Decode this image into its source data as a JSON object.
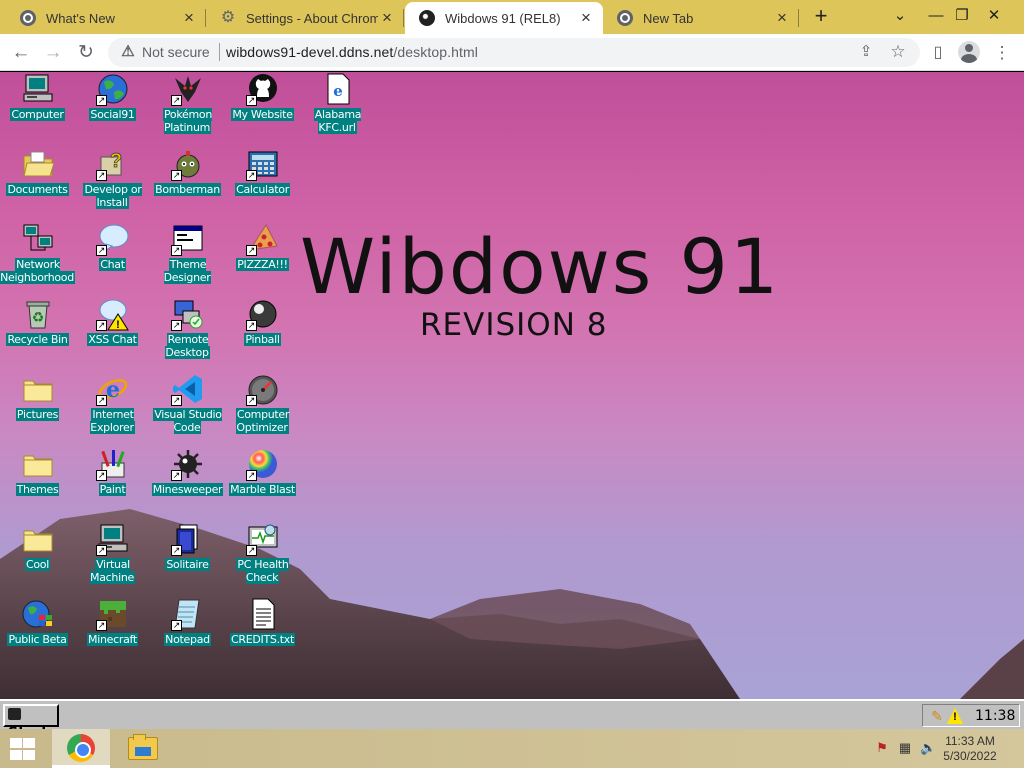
{
  "browser": {
    "tabs": [
      {
        "label": "What's New",
        "icon": "chrome-icon",
        "active": false
      },
      {
        "label": "Settings - About Chrome",
        "icon": "gear-icon",
        "active": false
      },
      {
        "label": "Wibdows 91 (REL8)",
        "icon": "wibdows-icon",
        "active": true
      },
      {
        "label": "New Tab",
        "icon": "chrome-icon",
        "active": false
      }
    ],
    "new_tab": "+",
    "tab_close": "×",
    "window_controls": {
      "dropdown": "⌄",
      "minimize": "—",
      "restore": "❐",
      "close": "✕"
    },
    "nav": {
      "back": "←",
      "forward": "→",
      "reload": "↻"
    },
    "security": "Not secure",
    "url_host": "wibdows91-devel.ddns.net",
    "url_path": "/desktop.html",
    "omni_icons": {
      "share": "⇪",
      "bookmark": "☆",
      "side_panel": "▯",
      "menu": "⋮"
    }
  },
  "desktop": {
    "title": "Wibdows 91",
    "subtitle": "REVISION 8",
    "icons": [
      {
        "label": "Computer",
        "shortcut": false,
        "kind": "computer"
      },
      {
        "label": "Social91",
        "shortcut": true,
        "kind": "globe"
      },
      {
        "label": "Pokémon Platinum",
        "shortcut": true,
        "kind": "giratina"
      },
      {
        "label": "My Website",
        "shortcut": true,
        "kind": "github"
      },
      {
        "label": "Alabama KFC.url",
        "shortcut": false,
        "kind": "ie-doc"
      },
      {
        "label": "Documents",
        "shortcut": false,
        "kind": "folder-open"
      },
      {
        "label": "Develop or Install",
        "shortcut": true,
        "kind": "help"
      },
      {
        "label": "Bomberman",
        "shortcut": true,
        "kind": "bomber"
      },
      {
        "label": "Calculator",
        "shortcut": true,
        "kind": "calculator"
      },
      {
        "label": "Network Neighborhood",
        "shortcut": false,
        "kind": "network"
      },
      {
        "label": "Chat",
        "shortcut": true,
        "kind": "bubble"
      },
      {
        "label": "Theme Designer",
        "shortcut": true,
        "kind": "window"
      },
      {
        "label": "PIZZZA!!!",
        "shortcut": true,
        "kind": "pizza"
      },
      {
        "label": "Recycle Bin",
        "shortcut": false,
        "kind": "recycle"
      },
      {
        "label": "XSS Chat",
        "shortcut": true,
        "kind": "bubble-warn"
      },
      {
        "label": "Remote Desktop",
        "shortcut": true,
        "kind": "remote"
      },
      {
        "label": "Pinball",
        "shortcut": true,
        "kind": "ball"
      },
      {
        "label": "Pictures",
        "shortcut": false,
        "kind": "folder"
      },
      {
        "label": "Internet Explorer",
        "shortcut": true,
        "kind": "ie"
      },
      {
        "label": "Visual Studio Code",
        "shortcut": true,
        "kind": "vscode"
      },
      {
        "label": "Computer Optimizer",
        "shortcut": true,
        "kind": "gauge"
      },
      {
        "label": "Themes",
        "shortcut": false,
        "kind": "folder"
      },
      {
        "label": "Paint",
        "shortcut": true,
        "kind": "paint"
      },
      {
        "label": "Minesweeper",
        "shortcut": true,
        "kind": "mine"
      },
      {
        "label": "Marble Blast",
        "shortcut": true,
        "kind": "marble"
      },
      {
        "label": "Cool",
        "shortcut": false,
        "kind": "folder"
      },
      {
        "label": "Virtual Machine",
        "shortcut": true,
        "kind": "computer"
      },
      {
        "label": "Solitaire",
        "shortcut": true,
        "kind": "cards"
      },
      {
        "label": "PC Health Check",
        "shortcut": true,
        "kind": "health"
      },
      {
        "label": "Public Beta",
        "shortcut": false,
        "kind": "globe-win"
      },
      {
        "label": "Minecraft",
        "shortcut": true,
        "kind": "block"
      },
      {
        "label": "Notepad",
        "shortcut": true,
        "kind": "notepad"
      },
      {
        "label": "CREDITS.txt",
        "shortcut": false,
        "kind": "text"
      }
    ]
  },
  "w91_taskbar": {
    "start_label": "Start",
    "clock": "11:38",
    "tray_icons": [
      "pencil-icon",
      "warning-icon"
    ]
  },
  "host_taskbar": {
    "apps": [
      "chrome",
      "file-explorer"
    ],
    "time": "11:33 AM",
    "date": "5/30/2022",
    "tray_icons": [
      "flag-icon",
      "network-icon",
      "volume-icon"
    ]
  },
  "colors": {
    "tab_strip": "#ddc55a",
    "icon_label_bg": "#008080",
    "w91_gray": "#c0c0c0"
  }
}
